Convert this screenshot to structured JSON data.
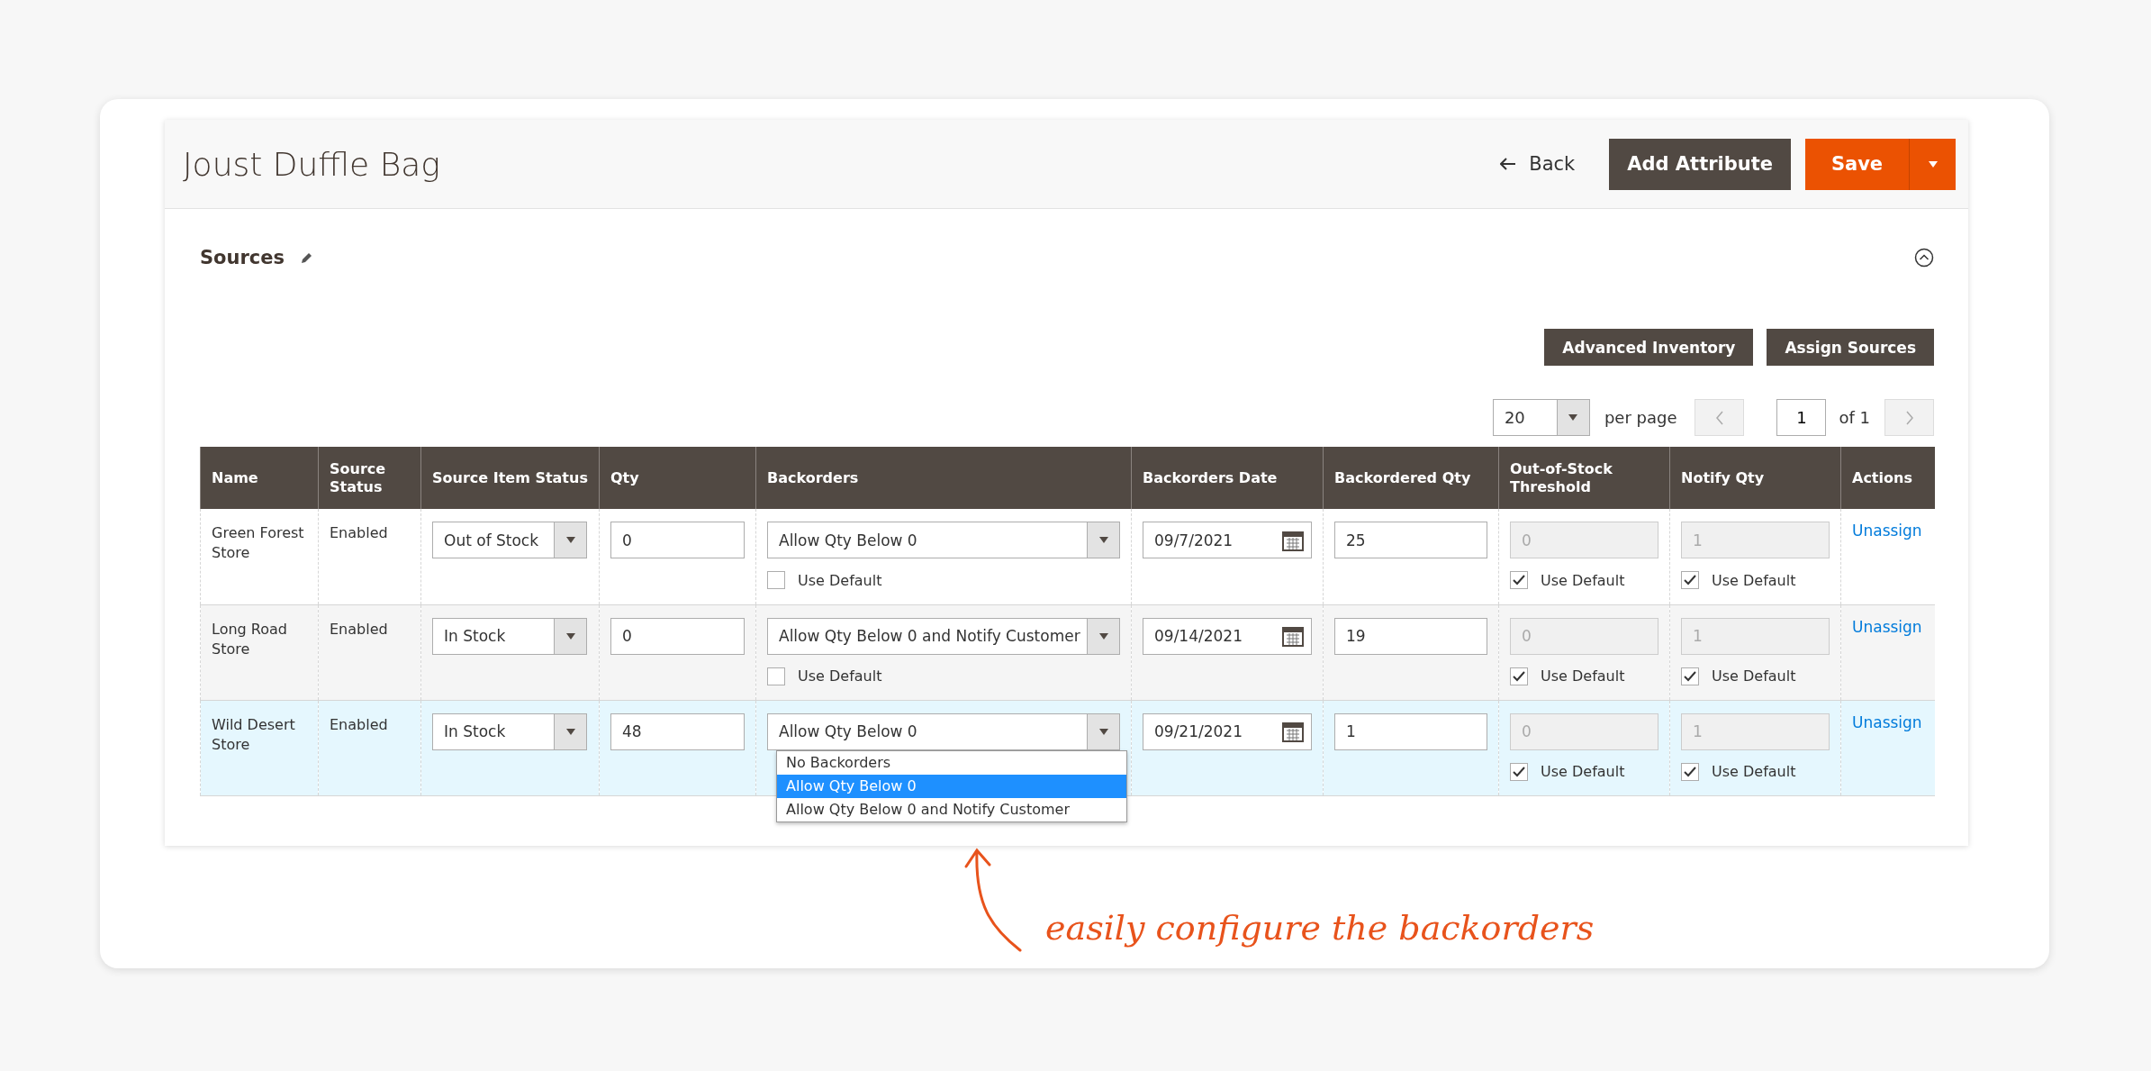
{
  "header": {
    "title": "Joust Duffle Bag",
    "back": "Back",
    "add_attribute": "Add Attribute",
    "save": "Save"
  },
  "section": {
    "title": "Sources",
    "buttons": [
      "Advanced Inventory",
      "Assign Sources"
    ]
  },
  "pager": {
    "per_page_value": "20",
    "per_page_label": "per page",
    "page": "1",
    "of": "of 1"
  },
  "table": {
    "columns": [
      "Name",
      "Source Status",
      "Source Item Status",
      "Qty",
      "Backorders",
      "Backorders Date",
      "Backordered Qty",
      "Out-of-Stock Threshold",
      "Notify Qty",
      "Actions"
    ],
    "rows": [
      {
        "name": "Green Forest Store",
        "status": "Enabled",
        "item_status": "Out of Stock",
        "qty": "0",
        "backorders": "Allow Qty Below 0",
        "backorders_default": {
          "label": "Use Default",
          "checked": false
        },
        "date": "09/7/2021",
        "backordered_qty": "25",
        "threshold": "0",
        "threshold_default": {
          "label": "Use Default",
          "checked": true
        },
        "notify": "1",
        "notify_default": {
          "label": "Use Default",
          "checked": true
        },
        "action": "Unassign",
        "active": false,
        "expanded": false
      },
      {
        "name": "Long Road Store",
        "status": "Enabled",
        "item_status": "In Stock",
        "qty": "0",
        "backorders": "Allow Qty Below 0 and Notify Customer",
        "backorders_default": {
          "label": "Use Default",
          "checked": false
        },
        "date": "09/14/2021",
        "backordered_qty": "19",
        "threshold": "0",
        "threshold_default": {
          "label": "Use Default",
          "checked": true
        },
        "notify": "1",
        "notify_default": {
          "label": "Use Default",
          "checked": true
        },
        "action": "Unassign",
        "active": false,
        "expanded": false
      },
      {
        "name": "Wild Desert Store",
        "status": "Enabled",
        "item_status": "In Stock",
        "qty": "48",
        "backorders": "Allow Qty Below 0",
        "options": [
          {
            "label": "No Backorders",
            "selected": false
          },
          {
            "label": "Allow Qty Below 0",
            "selected": true
          },
          {
            "label": "Allow Qty Below 0 and Notify Customer",
            "selected": false
          }
        ],
        "date": "09/21/2021",
        "backordered_qty": "1",
        "threshold": "0",
        "threshold_default": {
          "label": "Use Default",
          "checked": true
        },
        "notify": "1",
        "notify_default": {
          "label": "Use Default",
          "checked": true
        },
        "action": "Unassign",
        "active": true,
        "expanded": true
      }
    ]
  },
  "annotation": "easily configure the backorders"
}
